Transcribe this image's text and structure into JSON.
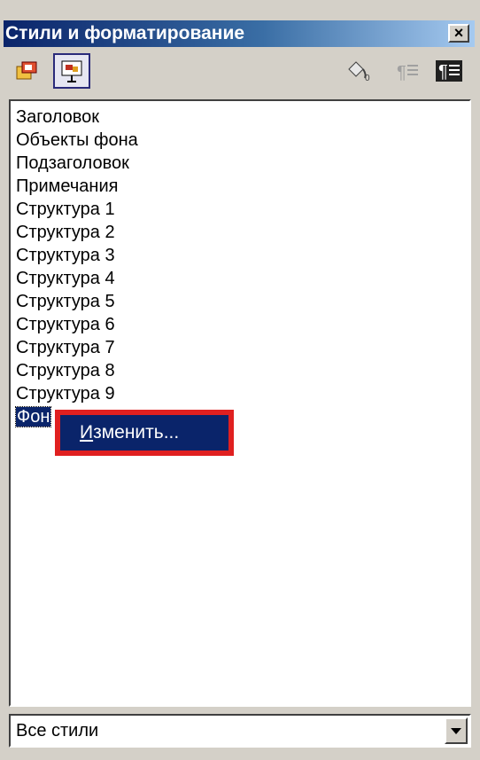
{
  "window": {
    "title": "Стили и форматирование",
    "close_glyph": "×"
  },
  "toolbar": {
    "left_buttons": [
      {
        "icon": "graphics-styles-icon",
        "active": false
      },
      {
        "icon": "presentation-styles-icon",
        "active": true
      }
    ],
    "right_buttons": [
      {
        "icon": "fill-format-mode-icon"
      },
      {
        "icon": "new-style-from-selection-icon"
      },
      {
        "icon": "update-style-icon"
      }
    ]
  },
  "styles_list": {
    "items": [
      "Заголовок",
      "Объекты фона",
      "Подзаголовок",
      "Примечания",
      "Структура 1",
      "Структура 2",
      "Структура 3",
      "Структура 4",
      "Структура 5",
      "Структура 6",
      "Структура 7",
      "Структура 8",
      "Структура 9",
      "Фон"
    ],
    "selected": "Фон"
  },
  "context_menu": {
    "item_accel": "И",
    "item_rest": "зменить..."
  },
  "filter": {
    "value": "Все стили"
  },
  "colors": {
    "title_start": "#0a246a",
    "title_end": "#a6caf0",
    "highlight": "#0a246a",
    "callout_border": "#e02020"
  }
}
